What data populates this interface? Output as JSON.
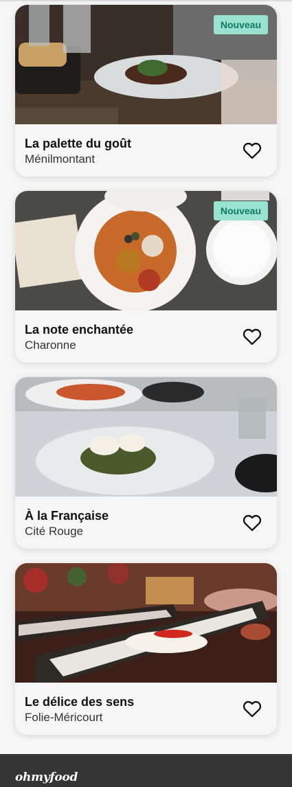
{
  "restaurants": [
    {
      "name": "La palette du goût",
      "area": "Ménilmontant",
      "badge": "Nouveau",
      "favorite_icon": "heart-outline-icon"
    },
    {
      "name": "La note enchantée",
      "area": "Charonne",
      "badge": "Nouveau",
      "favorite_icon": "heart-outline-icon"
    },
    {
      "name": "À la Française",
      "area": "Cité Rouge",
      "badge": "",
      "favorite_icon": "heart-outline-icon"
    },
    {
      "name": "Le délice des sens",
      "area": "Folie-Méricourt",
      "badge": "",
      "favorite_icon": "heart-outline-icon"
    }
  ],
  "footer": {
    "logo_text": "ohmyfood"
  },
  "colors": {
    "badge_bg": "#99e2d0",
    "badge_text": "#0f7a5e",
    "footer_bg": "#353535"
  }
}
